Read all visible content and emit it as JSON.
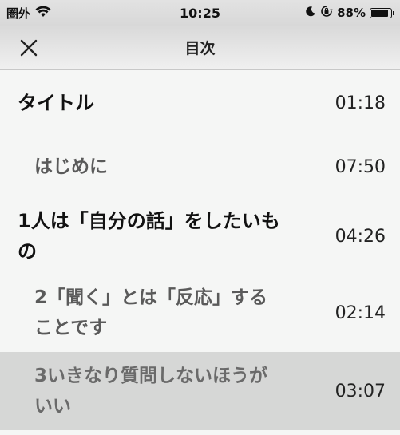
{
  "status": {
    "carrier": "圏外",
    "time": "10:25",
    "battery_text": "88%",
    "battery_level": 0.88
  },
  "nav": {
    "title": "目次"
  },
  "toc": [
    {
      "title": "タイトル",
      "time": "01:18",
      "level": 1,
      "selected": false
    },
    {
      "title": "はじめに",
      "time": "07:50",
      "level": 2,
      "selected": false
    },
    {
      "title": "1人は「自分の話」をしたいもの",
      "time": "04:26",
      "level": 1,
      "selected": false
    },
    {
      "title": "2「聞く」とは「反応」することです",
      "time": "02:14",
      "level": 2,
      "selected": false
    },
    {
      "title": "3いきなり質問しないほうがいい",
      "time": "03:07",
      "level": 2,
      "selected": true
    }
  ],
  "colors": {
    "background": "#f5f6f5",
    "selected_row": "#d6d7d6",
    "sub_item_text": "#5a5a5a"
  }
}
